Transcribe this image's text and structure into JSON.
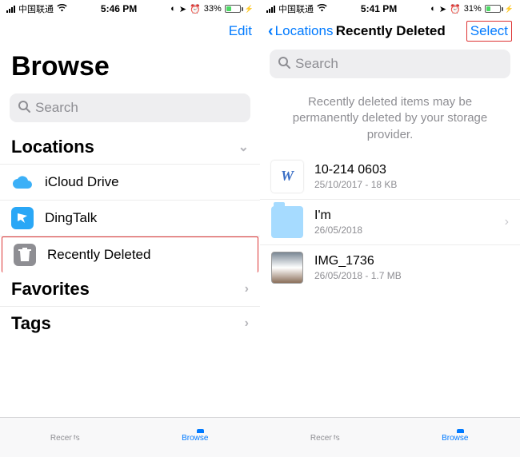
{
  "left": {
    "status": {
      "carrier": "中国联通",
      "time": "5:46 PM",
      "battery_pct": "33%"
    },
    "nav": {
      "edit": "Edit"
    },
    "title": "Browse",
    "search_placeholder": "Search",
    "sections": {
      "locations": {
        "label": "Locations",
        "items": [
          {
            "label": "iCloud Drive"
          },
          {
            "label": "DingTalk"
          },
          {
            "label": "Recently Deleted"
          }
        ]
      },
      "favorites": {
        "label": "Favorites"
      },
      "tags": {
        "label": "Tags"
      }
    },
    "tabs": {
      "recents": "Recents",
      "browse": "Browse"
    }
  },
  "right": {
    "status": {
      "carrier": "中国联通",
      "time": "5:41 PM",
      "battery_pct": "31%"
    },
    "nav": {
      "back": "Locations",
      "title": "Recently Deleted",
      "select": "Select"
    },
    "search_placeholder": "Search",
    "info": "Recently deleted items may be permanently deleted by your storage provider.",
    "files": [
      {
        "name": "10-214  0603",
        "meta": "25/10/2017 - 18 KB",
        "type": "doc"
      },
      {
        "name": "I'm",
        "meta": "26/05/2018",
        "type": "folder"
      },
      {
        "name": "IMG_1736",
        "meta": "26/05/2018 - 1.7 MB",
        "type": "image"
      }
    ],
    "tabs": {
      "recents": "Recents",
      "browse": "Browse"
    }
  }
}
